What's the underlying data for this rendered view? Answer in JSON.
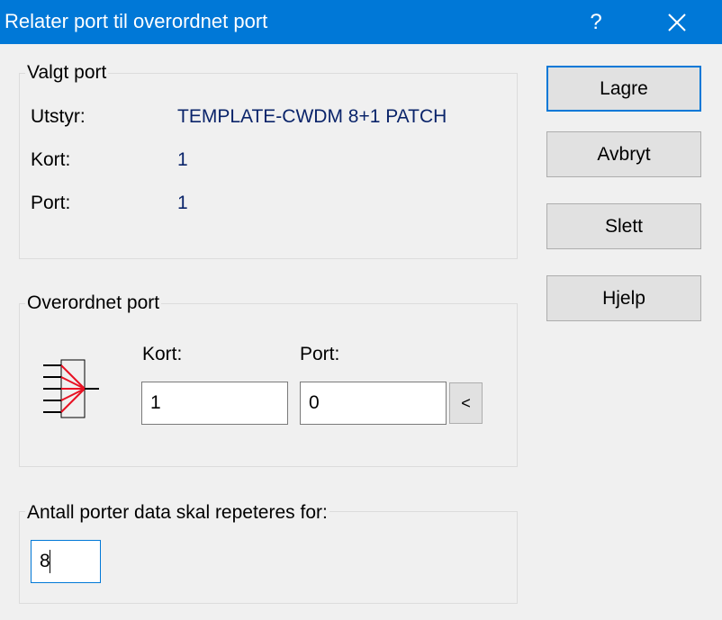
{
  "window": {
    "title": "Relater port til overordnet port",
    "help_label": "?",
    "close_icon": "close-icon"
  },
  "selected_port": {
    "group_label": "Valgt port",
    "equipment_label": "Utstyr:",
    "equipment_value": "TEMPLATE-CWDM 8+1 PATCH",
    "card_label": "Kort:",
    "card_value": "1",
    "port_label": "Port:",
    "port_value": "1"
  },
  "parent_port": {
    "group_label": "Overordnet port",
    "icon": "port-relation-icon",
    "card_label": "Kort:",
    "card_value": "1",
    "port_label": "Port:",
    "port_value": "0",
    "pick_button_label": "<"
  },
  "repeat": {
    "group_label": "Antall porter data skal repeteres for:",
    "value": "8"
  },
  "buttons": {
    "save": "Lagre",
    "cancel": "Avbryt",
    "delete": "Slett",
    "help": "Hjelp"
  },
  "colors": {
    "titlebar": "#0078d7",
    "value_text": "#0a246a",
    "icon_arrow": "#e81123"
  }
}
